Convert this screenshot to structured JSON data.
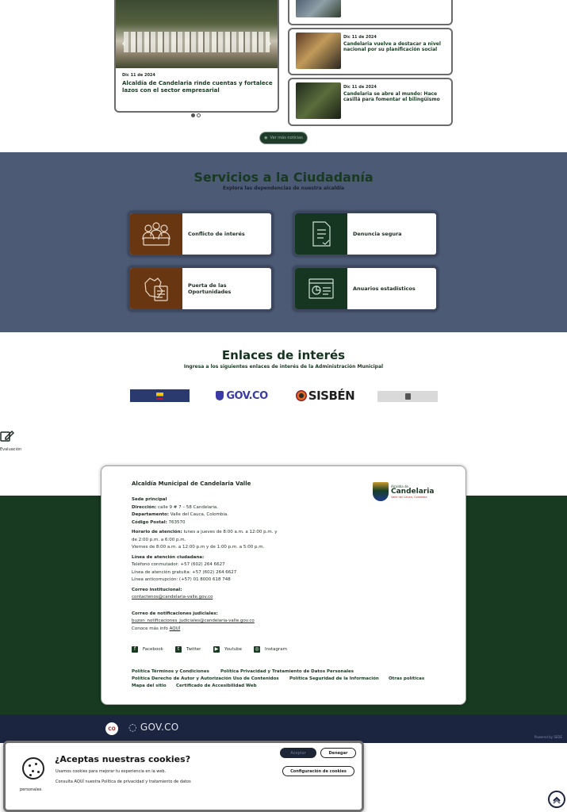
{
  "news": {
    "slider": {
      "date": "Dic 11 de 2024",
      "title": "Alcaldía de Candelaria rinde cuentas y fortalece lazos con el sector empresarial",
      "prev": "‹",
      "next": "›"
    },
    "cards": [
      {
        "date": "",
        "title": ""
      },
      {
        "date": "Dic 11 de 2024",
        "title": "Candelaria vuelve a destacar a nivel nacional por su planificación social"
      },
      {
        "date": "Dic 11 de 2024",
        "title": "Candelaria se abre al mundo: Hace casillá para fomentar el bilingüismo"
      }
    ],
    "more_label": "Ver más noticias"
  },
  "services": {
    "title": "Servicios a la Ciudadanía",
    "subtitle": "Explora las dependencias de nuestra alcaldía",
    "items": [
      {
        "label": "Conflicto de interés",
        "icon": "people-desk-icon"
      },
      {
        "label": "Denuncia segura",
        "icon": "document-icon"
      },
      {
        "label": "Puerta de las Oportunidades",
        "icon": "map-document-icon"
      },
      {
        "label": "Anuarios estadísticos",
        "icon": "stats-document-icon"
      }
    ]
  },
  "links": {
    "title": "Enlaces de interés",
    "subtitle": "Ingresa a los siguientes enlaces de interés de la Administración Municipal",
    "govco": "GOV.CO",
    "sisben": "SISBÉN"
  },
  "feedback": {
    "label": "Evaluación"
  },
  "footer": {
    "entity": "Alcaldía Municipal de Candelaria Valle",
    "logo": {
      "line1": "Alcaldía de",
      "line2": "Candelaria",
      "line3": "Valle del Cauca, Colombia"
    },
    "sede_heading": "Sede principal",
    "address_label": "Dirección:",
    "address": "calle 9 # 7 – 58 Candelaria.",
    "dept_label": "Departamento:",
    "dept": "Valle del Cauca, Colombia.",
    "postal_label": "Código Postal:",
    "postal": "763570",
    "hours_label": "Horario de atención:",
    "hours1": "lunes a jueves de 8:00 a.m. a 12:00 p.m. y",
    "hours2": "de 2:00 p.m. a 6:00 p.m.",
    "hours3": "Viernes de 8:00 a.m. a 12:00 p.m y de 1:00 p.m. a 5:00 p.m.",
    "lines_heading": "Línea de atención ciudadana:",
    "phone1": "Teléfono conmutador: +57 (602) 264 6627",
    "phone2": "Línea de atención gratuita: +57 (602) 264 6627",
    "phone3": "Línea anticorrupción: (+57) 01 8000 618 748",
    "email_heading": "Correo institucional:",
    "email": "contactenos@candelaria-valle.gov.co",
    "judicial_heading": "Correo de notificaciones judiciales:",
    "judicial_email": "buzon_notificaciones_judiciales@candelaria-valle.gov.co",
    "more_info": "Conoce más info",
    "more_info_link": "AQUÍ",
    "social": [
      {
        "label": "Facebook",
        "icon": "facebook-icon",
        "glyph": "f"
      },
      {
        "label": "Twitter",
        "icon": "twitter-icon",
        "glyph": "t"
      },
      {
        "label": "Youtube",
        "icon": "youtube-icon",
        "glyph": "▶"
      },
      {
        "label": "Instagram",
        "icon": "instagram-icon",
        "glyph": "◎"
      }
    ],
    "policies": {
      "terms": "Política Términos y Condiciones",
      "privacy": "Política Privacidad y Tratamiento de Datos Personales",
      "copyright": "Política Derecho de Autor y Autorización Uso de Contenidos",
      "security": "Política Seguridad de la Información",
      "other": "Otras políticas",
      "sitemap": "Mapa del sitio",
      "accessibility": "Certificado de Accesibilidad Web"
    }
  },
  "govbar": {
    "badge": "CO",
    "govco": "GOV.CO",
    "powered": "Powered by SEDE"
  },
  "cookies": {
    "title": "¿Aceptas nuestras cookies?",
    "text1": "Usamos cookies para mejorar tu experiencia en la web.",
    "text2": "Consulta AQUÍ nuestra Política de privacidad y tratamiento de datos",
    "text3": "personales.",
    "accept": "Aceptar",
    "deny": "Denegar",
    "config": "Configuración de cookies"
  },
  "colors": {
    "green": "#173a20",
    "brown": "#683711",
    "slate": "#4c5a76",
    "navy": "#1b2540"
  }
}
